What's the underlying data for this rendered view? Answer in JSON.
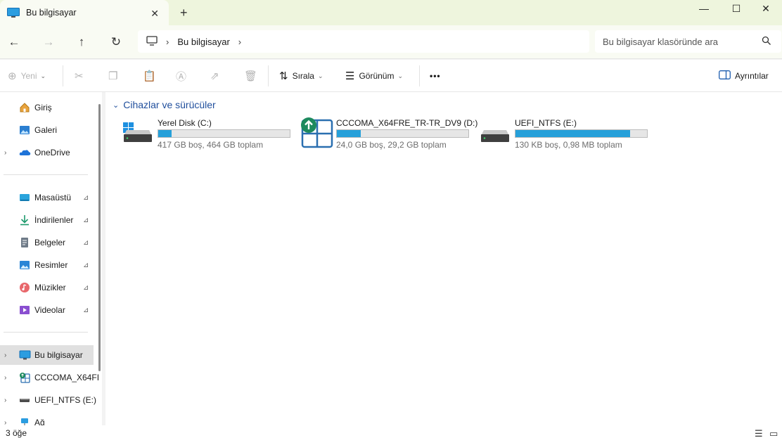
{
  "window": {
    "tab_title": "Bu bilgisayar",
    "tab_close": "✕",
    "new_tab": "+",
    "minimize": "—",
    "maximize": "☐",
    "close": "✕"
  },
  "nav": {
    "back": "←",
    "forward": "→",
    "up": "↑",
    "refresh": "↻"
  },
  "address": {
    "crumb": "Bu bilgisayar",
    "chevron": "›"
  },
  "search": {
    "placeholder": "Bu bilgisayar klasöründe ara"
  },
  "toolbar": {
    "new_label": "Yeni",
    "sort_label": "Sırala",
    "view_label": "Görünüm",
    "more_label": "•••",
    "details_label": "Ayrıntılar",
    "chevron": "⌄"
  },
  "sidebar": {
    "items": [
      {
        "label": "Giriş",
        "icon": "home-icon"
      },
      {
        "label": "Galeri",
        "icon": "gallery-icon"
      },
      {
        "label": "OneDrive",
        "icon": "onedrive-icon"
      },
      {
        "label": "Masaüstü",
        "icon": "desktop-icon",
        "pinned": true
      },
      {
        "label": "İndirilenler",
        "icon": "download-icon",
        "pinned": true
      },
      {
        "label": "Belgeler",
        "icon": "documents-icon",
        "pinned": true
      },
      {
        "label": "Resimler",
        "icon": "pictures-icon",
        "pinned": true
      },
      {
        "label": "Müzikler",
        "icon": "music-icon",
        "pinned": true
      },
      {
        "label": "Videolar",
        "icon": "videos-icon",
        "pinned": true
      },
      {
        "label": "Bu bilgisayar",
        "icon": "computer-icon",
        "selected": true
      },
      {
        "label": "CCCOMA_X64FI",
        "icon": "setup-drive-icon"
      },
      {
        "label": "UEFI_NTFS (E:)",
        "icon": "drive-icon"
      },
      {
        "label": "Ağ",
        "icon": "network-icon"
      }
    ],
    "expander": "›",
    "pin": "📌"
  },
  "content": {
    "group_title": "Cihazlar ve sürücüler",
    "group_chevron": "⌄",
    "drives": [
      {
        "name": "Yerel Disk (C:)",
        "size": "417 GB boş, 464 GB toplam",
        "used_fraction": 0.1,
        "icon": "windows-drive-icon"
      },
      {
        "name": "CCCOMA_X64FRE_TR-TR_DV9 (D:)",
        "size": "24,0 GB boş, 29,2 GB toplam",
        "used_fraction": 0.18,
        "icon": "setup-drive-icon"
      },
      {
        "name": "UEFI_NTFS (E:)",
        "size": "130 KB boş, 0,98 MB toplam",
        "used_fraction": 0.87,
        "icon": "drive-icon"
      }
    ]
  },
  "status": {
    "item_count": "3 öğe"
  },
  "colors": {
    "accent": "#26a0da",
    "group_title": "#1f4e9c",
    "titlebar": "#eef5dd"
  }
}
